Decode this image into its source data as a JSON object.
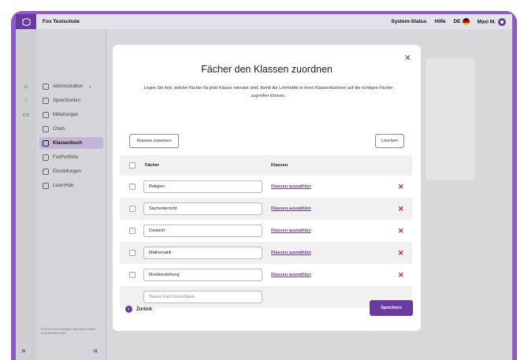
{
  "topbar": {
    "title": "Fox Testschule",
    "system_status": "System-Status",
    "help": "Hilfe",
    "language": "DE",
    "user": "Maxi M."
  },
  "sidebar": {
    "items": [
      {
        "label": "Administration",
        "icon": "admin-icon"
      },
      {
        "label": "Sprechzeiten",
        "icon": "handshake-icon"
      },
      {
        "label": "Mitteilungen",
        "icon": "mail-icon"
      },
      {
        "label": "Chats",
        "icon": "chat-icon"
      },
      {
        "label": "Klassenbuch",
        "icon": "book-icon"
      },
      {
        "label": "FoxPortfolio",
        "icon": "portfolio-icon"
      },
      {
        "label": "Einstellungen",
        "icon": "gear-icon"
      },
      {
        "label": "LearnHub",
        "icon": "graduation-icon"
      }
    ],
    "active_index": 4,
    "copyright_line1": "© 2024 Fox Education Services GmbH",
    "copyright_line2": "foxeducation.com"
  },
  "modal": {
    "title": "Fächer den Klassen zuordnen",
    "description": "Legen Sie fest, welche Fächer für jede Klasse relevant sind, damit die Lehrkräfte in ihren Klassenbüchern auf die richtigen Fächer zugreifen können.",
    "assign_button": "Klassen zuweisen",
    "delete_button": "Löschen",
    "table": {
      "col_subjects": "Fächer",
      "col_classes": "Klassen",
      "rows": [
        {
          "subject": "Religion",
          "link": "Klassen auswählen"
        },
        {
          "subject": "Sachunterricht",
          "link": "Klassen auswählen"
        },
        {
          "subject": "Deutsch",
          "link": "Klassen auswählen"
        },
        {
          "subject": "Mathematik",
          "link": "Klassen auswählen"
        },
        {
          "subject": "Musikerziehung",
          "link": "Klassen auswählen"
        }
      ],
      "new_placeholder": "Neues Fach hinzufügen"
    },
    "back_label": "Zurück",
    "save_label": "Speichern"
  },
  "colors": {
    "accent": "#6a3aa3",
    "frame": "#8b5bc8",
    "delete": "#d9163c"
  }
}
